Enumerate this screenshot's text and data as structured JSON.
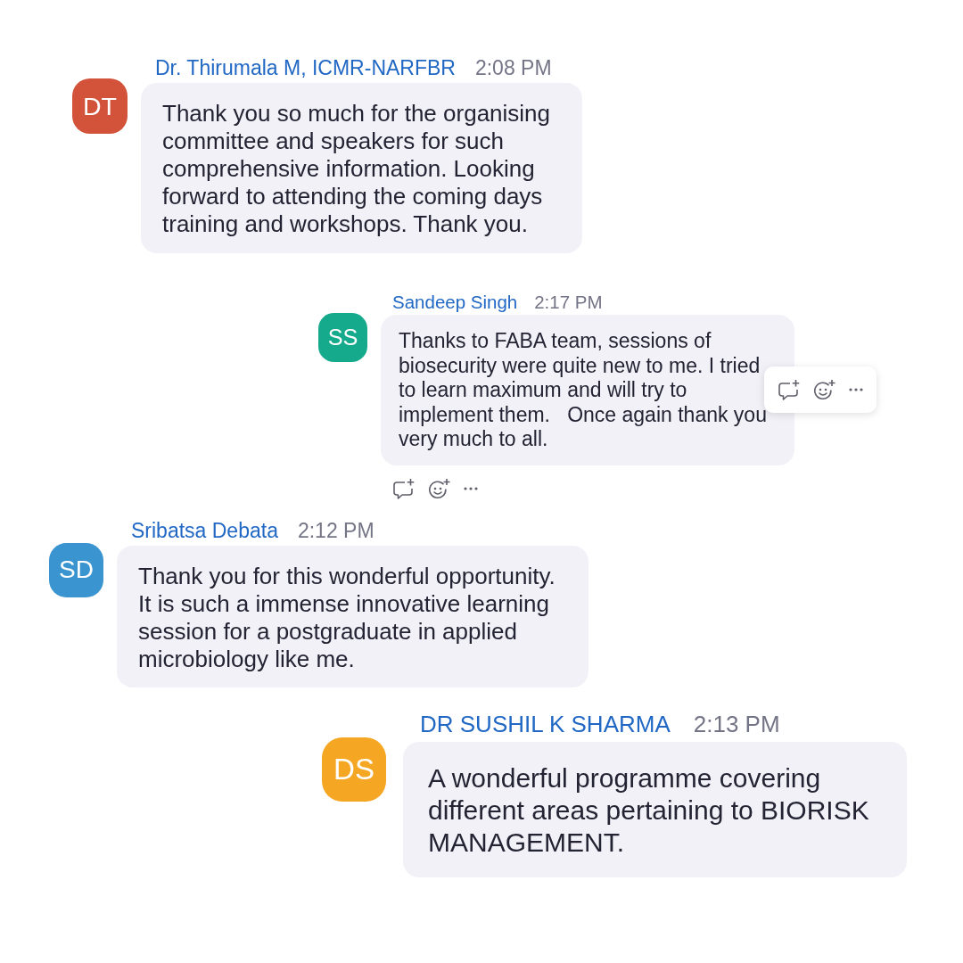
{
  "messages": [
    {
      "initials": "DT",
      "color": "#d3523a",
      "sender": "Dr. Thirumala M, ICMR-NARFBR",
      "time": "2:08 PM",
      "text": "Thank you so much for the organising committee and speakers for such comprehensive information. Looking forward to attending the coming days training and workshops. Thank you.",
      "hovered": false,
      "actions_shown": false
    },
    {
      "initials": "SS",
      "color": "#15aa8c",
      "sender": "Sandeep Singh",
      "time": "2:17 PM",
      "text": "Thanks to FABA team, sessions of biosecurity were quite new to me. I tried to learn maximum and will try to implement them.   Once again thank you very much to all.",
      "hovered": true,
      "actions_shown": true
    },
    {
      "initials": "SD",
      "color": "#3a94cf",
      "sender": "Sribatsa Debata",
      "time": "2:12 PM",
      "text": "Thank you for this wonderful opportunity. It is such a immense innovative learning session for a postgraduate in applied microbiology like me.",
      "hovered": false,
      "actions_shown": false
    },
    {
      "initials": "DS",
      "color": "#f5a623",
      "sender": "DR SUSHIL K SHARMA",
      "time": "2:13 PM",
      "text": "A wonderful programme covering different areas pertaining to BIORISK MANAGEMENT.",
      "hovered": false,
      "actions_shown": false
    }
  ]
}
